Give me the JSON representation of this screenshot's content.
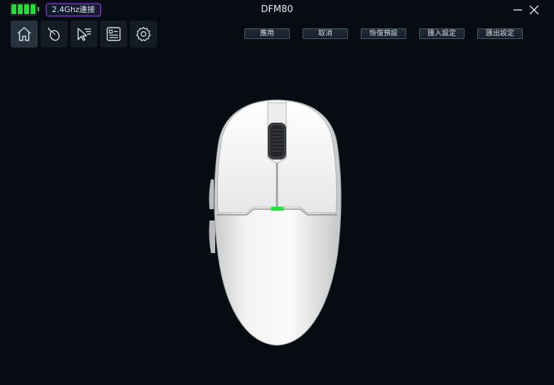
{
  "status": {
    "battery_cells": 4,
    "connection_label": "2.4Ghz連接"
  },
  "window": {
    "title": "DFM80",
    "minimize_icon": "minimize-icon",
    "close_icon": "close-icon"
  },
  "nav": {
    "items": [
      {
        "icon": "home-icon",
        "active": true
      },
      {
        "icon": "mouse-buttons-icon",
        "active": false
      },
      {
        "icon": "pointer-settings-icon",
        "active": false
      },
      {
        "icon": "macro-list-icon",
        "active": false
      },
      {
        "icon": "gear-icon",
        "active": false
      }
    ]
  },
  "actions": {
    "apply": "應用",
    "cancel": "取消",
    "restore_default": "恢復預設",
    "import_settings": "匯入設定",
    "export_settings": "匯出設定"
  },
  "colors": {
    "background": "#060c11",
    "battery": "#27d93a",
    "connection_border": "#8b3fd9",
    "led": "#22e33a"
  }
}
